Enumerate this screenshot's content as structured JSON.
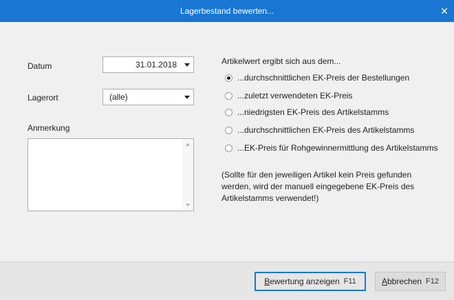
{
  "window": {
    "title": "Lagerbestand bewerten...",
    "close_glyph": "✕",
    "accent": "#1976d2"
  },
  "form": {
    "datum_label": "Datum",
    "datum_value": "31.01.2018",
    "lagerort_label": "Lagerort",
    "lagerort_value": "(alle)",
    "anmerkung_label": "Anmerkung",
    "anmerkung_value": ""
  },
  "artikelwert": {
    "heading": "Artikelwert ergibt sich aus dem...",
    "options": [
      {
        "label": "...durchschnittlichen EK-Preis der Bestellungen",
        "checked": true
      },
      {
        "label": "...zuletzt verwendeten EK-Preis",
        "checked": false
      },
      {
        "label": "...niedrigsten EK-Preis des Artikelstamms",
        "checked": false
      },
      {
        "label": "...durchschnittlichen EK-Preis des Artikelstamms",
        "checked": false
      },
      {
        "label": "...EK-Preis für Rohgewinnermittlung des Artikelstamms",
        "checked": false
      }
    ],
    "note": "(Sollte für den jeweiligen Artikel kein Preis gefunden werden, wird der manuell eingegebene EK-Preis des Artikelstamms verwendet!)"
  },
  "footer": {
    "show_accel": "B",
    "show_rest": "ewertung anzeigen",
    "show_key": "F11",
    "cancel_accel": "A",
    "cancel_rest": "bbrechen",
    "cancel_key": "F12"
  }
}
